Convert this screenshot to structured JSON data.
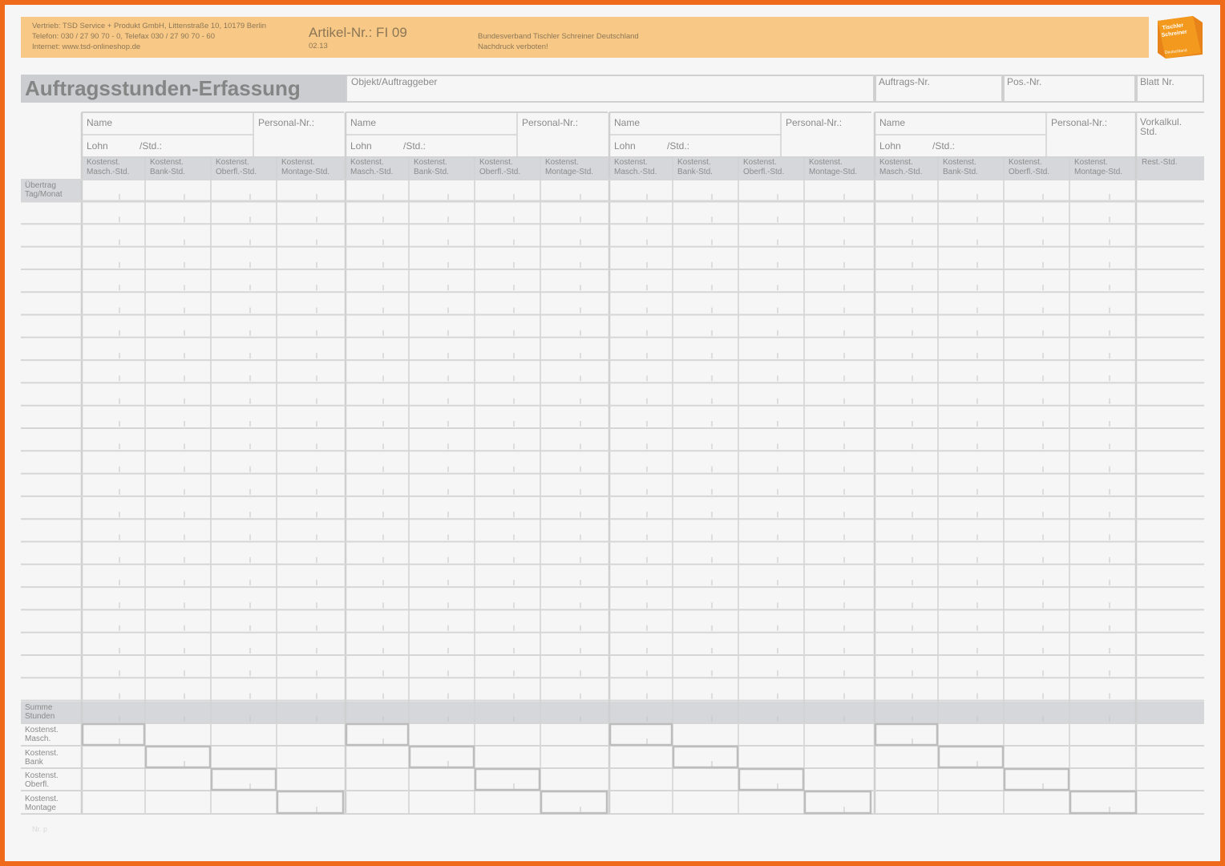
{
  "header": {
    "vertrieb_lines": [
      "Vertrieb: TSD Service + Produkt GmbH, Littenstraße 10, 10179 Berlin",
      "Telefon: 030 / 27 90 70 - 0, Telefax 030 / 27 90 70 - 60",
      "Internet: www.tsd-onlineshop.de"
    ],
    "artikel": "Artikel-Nr.: FI 09",
    "artikel_date": "02.13",
    "verband_lines": [
      "Bundesverband Tischler Schreiner Deutschland",
      "Nachdruck verboten!"
    ]
  },
  "logo": {
    "line1": "Tischler",
    "line2": "Schreiner",
    "line3": "Deutschland",
    "color": "#f39a1e"
  },
  "form": {
    "title": "Auftragsstunden-Erfassung",
    "objekt_label": "Objekt/Auftraggeber",
    "auftrags_label": "Auftrags-Nr.",
    "pos_label": "Pos.-Nr.",
    "blatt_label": "Blatt Nr."
  },
  "person_block": {
    "name_label": "Name",
    "personal_label": "Personal-Nr.:",
    "lohn_label": "Lohn",
    "std_label": "/Std.:",
    "cost_columns": [
      [
        "Kostenst.",
        "Masch.-Std."
      ],
      [
        "Kostenst.",
        "Bank-Std."
      ],
      [
        "Kostenst.",
        "Oberfl.-Std."
      ],
      [
        "Kostenst.",
        "Montage-Std."
      ]
    ]
  },
  "vorkalkul": {
    "line1": "Vorkalkul.",
    "line2": "Std.",
    "rest": "Rest.-Std."
  },
  "row_labels": {
    "uebertrag": [
      "Übertrag",
      "Tag/Monat"
    ],
    "summe": [
      "Summe",
      "Stunden"
    ],
    "bottom": [
      [
        "Kostenst.",
        "Masch."
      ],
      [
        "Kostenst.",
        "Bank"
      ],
      [
        "Kostenst.",
        "Oberfl."
      ],
      [
        "Kostenst.",
        "Montage"
      ]
    ]
  },
  "colors": {
    "border": "#f06a1c",
    "band": "#f8c986",
    "grey": "#cbcdd0"
  },
  "footer_note": "Nr. p"
}
